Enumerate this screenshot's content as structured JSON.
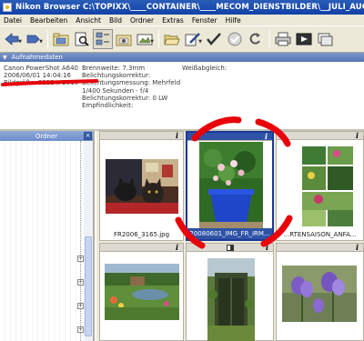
{
  "window": {
    "title": "Nikon Browser C:\\TOPIXX\\____CONTAINER\\____MECOM_DIENSTBILDER\\__JULI_AUGUST_I"
  },
  "menu": [
    "Datei",
    "Bearbeiten",
    "Ansicht",
    "Bild",
    "Ordner",
    "Extras",
    "Fenster",
    "Hilfe"
  ],
  "toolbar": {
    "icons": [
      "back-arrow-icon",
      "forward-tag-icon",
      "folder-up-icon",
      "find-icon",
      "metadata-view-icon",
      "thumbnail-view-icon",
      "image-view-icon",
      "open-folder-icon",
      "edit-icon",
      "checkmark-icon",
      "protect-icon",
      "rotate-icon",
      "print-icon",
      "slideshow-icon",
      "transfer-icon"
    ]
  },
  "metadata_panel": {
    "title": "Aufnahmedaten",
    "camera": "Canon PowerShot A640",
    "datetime": "2006/06/01 14:04:16",
    "image_size": "Bildgröße: 2112 x 2816",
    "focal_length": "Brennweite: 7.3mm",
    "exposure_correction": "Belichtungskorrektur:",
    "metering": "Belichtungsmessung: Mehrfeld",
    "shutter_aperture": "1/400 Sekunden - f/4",
    "exposure_comp": "Belichtungskorrektur: 0 LW",
    "sensitivity": "Empfindlichkeit:",
    "white_balance": "Weißabgleich:"
  },
  "folder_panel": {
    "title": "Ordner",
    "close": "×"
  },
  "thumbnails": [
    {
      "caption": "FR2006_3165.jpg",
      "selected": false,
      "info": "i"
    },
    {
      "caption": "20080601_IMG_FR_IRM...",
      "selected": true,
      "info": "i"
    },
    {
      "caption": "...RTENSAISON_ANFA...",
      "selected": false,
      "info": "i"
    },
    {
      "caption": "",
      "selected": false,
      "info": "i"
    },
    {
      "caption": "",
      "selected": false,
      "info": "i"
    },
    {
      "caption": "",
      "selected": false,
      "info": "i"
    }
  ],
  "colors": {
    "title_bar": "#1241a8",
    "selection": "#2f52a6",
    "marker": "#e8000a",
    "chrome": "#ece9d8"
  }
}
